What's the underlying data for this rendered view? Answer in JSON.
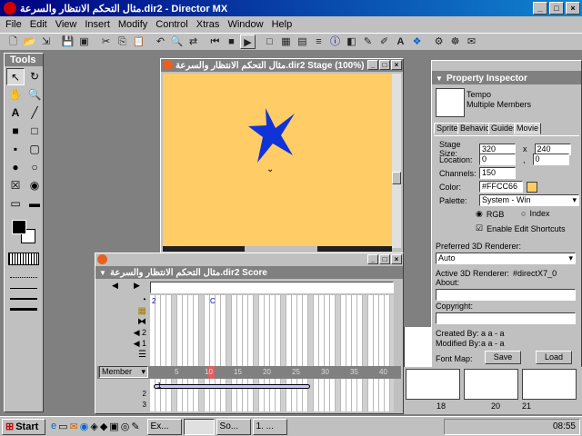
{
  "window": {
    "title": "مثال التحكم الانتظار والسرعة.dir2 - Director MX"
  },
  "menu": [
    "File",
    "Edit",
    "View",
    "Insert",
    "Modify",
    "Control",
    "Xtras",
    "Window",
    "Help"
  ],
  "toolbar_icons": [
    "new",
    "open",
    "import",
    "save",
    "save-all",
    "cut",
    "copy",
    "paste",
    "undo",
    "find",
    "exchange",
    "rewind",
    "stop",
    "play",
    "stage",
    "score",
    "cast",
    "script",
    "message",
    "behavior",
    "text",
    "paint",
    "vector",
    "shockwave"
  ],
  "tools": {
    "title": "Tools",
    "items": [
      "arrow",
      "rotate",
      "hand",
      "zoom",
      "text",
      "line",
      "rect",
      "round-rect",
      "filled-rect",
      "filled-round-rect",
      "ellipse",
      "filled-ellipse",
      "checkbox",
      "radio",
      "field",
      "button"
    ]
  },
  "stage": {
    "title": "مثال التحكم الانتظار والسرعة.dir2 Stage (100%)",
    "bgcolor": "#FFCC66",
    "sprite": "blue-star"
  },
  "score": {
    "title": "مثال التحكم الانتظار والسرعة.dir2 Score",
    "frame_numbers": [
      "5",
      "10",
      "15",
      "20",
      "25",
      "30",
      "35",
      "40"
    ],
    "member_label": "Member",
    "channel_rows": [
      "tempo",
      "palette",
      "transition",
      "2",
      "1",
      "script",
      "1",
      "2",
      "3"
    ],
    "markers": [
      "2",
      "C"
    ],
    "sprite_span_label": "1"
  },
  "property_inspector": {
    "title": "Property Inspector",
    "header_name": "Tempo",
    "header_sub": "Multiple Members",
    "tabs": [
      "Sprite",
      "Behavior",
      "Guides",
      "Movie"
    ],
    "stage_size_label": "Stage Size:",
    "stage_w": "320",
    "stage_x": "x",
    "stage_h": "240",
    "location_label": "Location:",
    "loc_x": "0",
    "loc_sep": ",",
    "loc_y": "0",
    "channels_label": "Channels:",
    "channels": "150",
    "color_label": "Color:",
    "color_value": "#FFCC66",
    "palette_label": "Palette:",
    "palette_value": "System - Win",
    "rgb_label": "RGB",
    "index_label": "Index",
    "edit_shortcuts_label": "Enable Edit Shortcuts",
    "renderer_label": "Preferred 3D Renderer:",
    "renderer_value": "Auto",
    "active_renderer_label": "Active 3D Renderer:",
    "active_renderer_value": "#directX7_0",
    "about_label": "About:",
    "copyright_label": "Copyright:",
    "created_label": "Created By:",
    "created_value": "a a - a",
    "modified_label": "Modified By:",
    "modified_value": "a a - a",
    "fontmap_label": "Font Map:",
    "save_label": "Save",
    "load_label": "Load"
  },
  "cast_numbers": [
    "18",
    "20",
    "21"
  ],
  "taskbar": {
    "start_label": "Start",
    "tasks": [
      "Ex...",
      "",
      "So...",
      "1. ..."
    ],
    "clock": "08:55"
  }
}
